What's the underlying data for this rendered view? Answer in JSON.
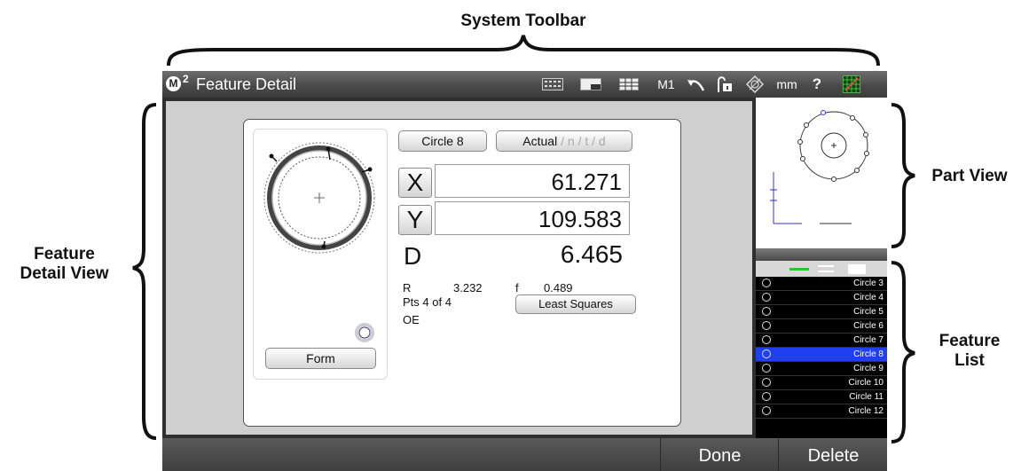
{
  "annotations": {
    "system_toolbar": "System Toolbar",
    "feature_detail_view_1": "Feature",
    "feature_detail_view_2": "Detail View",
    "part_view": "Part View",
    "feature_list_1": "Feature",
    "feature_list_2": "List"
  },
  "toolbar": {
    "logo": "M",
    "logo_sup": "2",
    "title": "Feature Detail",
    "m1_label": "M1",
    "unit_label": "mm",
    "help_label": "?",
    "icons": [
      "keypad-icon",
      "window-icon",
      "table-icon",
      "undo-icon",
      "lock-icon",
      "probe-icon",
      "grid-icon"
    ]
  },
  "detail": {
    "feature_name": "Circle 8",
    "mode_active": "Actual",
    "mode_rest": " / n / t / d",
    "x_label": "X",
    "x_value": "61.271",
    "y_label": "Y",
    "y_value": "109.583",
    "d_label": "D",
    "d_value": "6.465",
    "r_label": "R",
    "r_value": "3.232",
    "f_label": "f",
    "f_value": "0.489",
    "pts": "Pts 4 of 4",
    "oe": "OE",
    "fit_button": "Least Squares",
    "form_button": "Form"
  },
  "feature_list": {
    "items": [
      "Circle 3",
      "Circle 4",
      "Circle 5",
      "Circle 6",
      "Circle 7",
      "Circle 8",
      "Circle 9",
      "Circle 10",
      "Circle 11",
      "Circle 12"
    ],
    "selected": "Circle 8"
  },
  "bottom": {
    "done": "Done",
    "delete": "Delete"
  },
  "colors": {
    "selected_row": "#1f3ff0",
    "toolbar": "#4a4a4a"
  }
}
